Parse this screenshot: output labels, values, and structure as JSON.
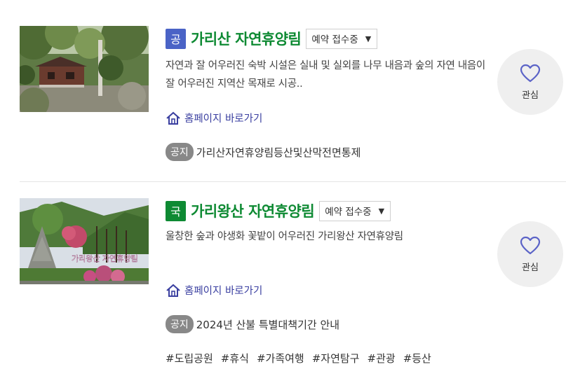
{
  "forests": [
    {
      "badge": "공",
      "badge_color": "#4a63c6",
      "title": "가리산 자연휴양림",
      "status": "예약 접수중",
      "description": " 자연과 잘 어우러진 숙박 시설은 실내 및 실외를 나무 내음과 숲의 자연 내음이 잘 어우러진 지역산 목재로 시공..",
      "homepage_label": "홈페이지 바로가기",
      "notice_label": "공지",
      "notice_text": "가리산자연휴양림등산및산막전면통제",
      "favorite_label": "관심"
    },
    {
      "badge": "국",
      "badge_color": "#0e8a33",
      "title": "가리왕산 자연휴양림",
      "status": "예약 접수중",
      "description": "울창한 숲과 야생화 꽃밭이 어우러진 가리왕산 자연휴양림",
      "homepage_label": "홈페이지 바로가기",
      "notice_label": "공지",
      "notice_text": "2024년 산불 특별대책기간 안내",
      "favorite_label": "관심",
      "image_sign_text": "가리왕산 자연휴양림",
      "tags": [
        "#도립공원",
        "#휴식",
        "#가족여행",
        "#자연탐구",
        "#관광",
        "#등산"
      ]
    }
  ],
  "colors": {
    "title_green": "#0e8a33",
    "link_blue": "#3a3fa0",
    "heart_outline": "#5b63c7",
    "fav_bg": "#efefef"
  },
  "icons": [
    "house-icon",
    "heart-icon",
    "dropdown-arrow-icon"
  ]
}
